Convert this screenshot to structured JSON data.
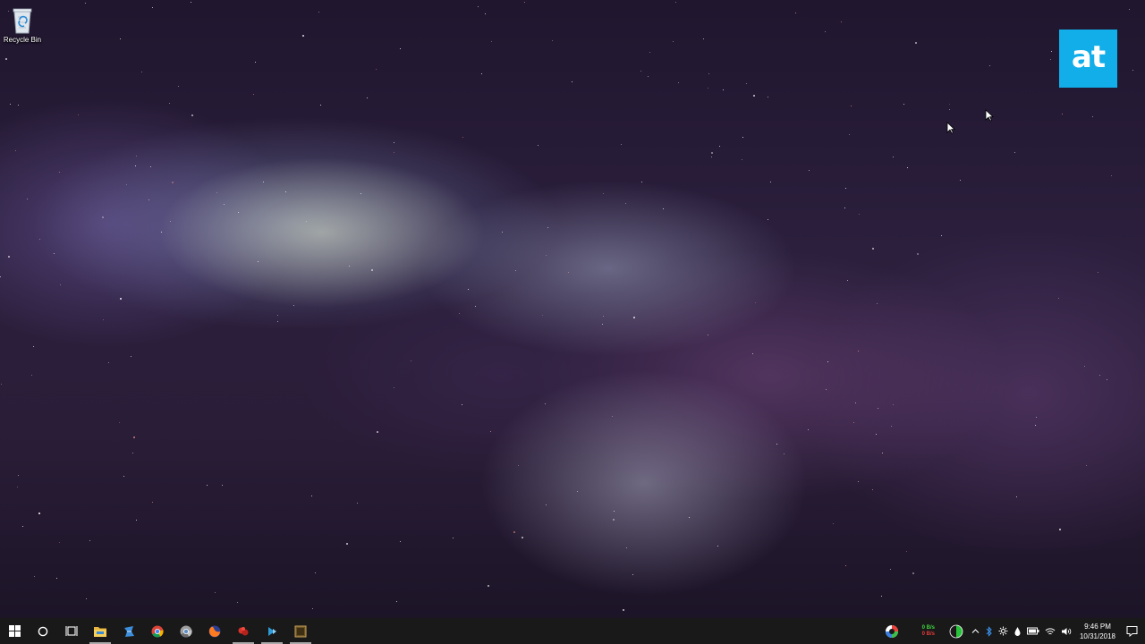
{
  "desktop": {
    "icons": [
      {
        "label": "Recycle Bin",
        "icon": "recycle-bin-icon"
      }
    ],
    "watermark": {
      "text": "at",
      "color": "#11aee9"
    }
  },
  "taskbar": {
    "background": "#191919",
    "pinned": [
      {
        "name": "start-button",
        "icon": "windows-logo-icon"
      },
      {
        "name": "search-button",
        "icon": "cortana-circle-icon"
      },
      {
        "name": "task-view-button",
        "icon": "task-view-icon"
      },
      {
        "name": "file-explorer-button",
        "icon": "folder-icon",
        "running": true
      },
      {
        "name": "app-button",
        "icon": "blue-ribbon-icon"
      },
      {
        "name": "chrome-button",
        "icon": "chrome-icon"
      },
      {
        "name": "chrome-canary-button",
        "icon": "chrome-icon"
      },
      {
        "name": "firefox-button",
        "icon": "firefox-icon"
      },
      {
        "name": "app-red-button",
        "icon": "red-app-icon",
        "running": true
      },
      {
        "name": "app-blue-button",
        "icon": "blue-app-icon",
        "running": true
      },
      {
        "name": "app-box-button",
        "icon": "box-app-icon",
        "running": true
      }
    ],
    "tray": {
      "net_speed": {
        "up": "0 B/s",
        "down": "0 B/s"
      },
      "icons": [
        "color-wheel-icon",
        "green-status-icon",
        "chevron-up-icon",
        "bluetooth-icon",
        "gear-icon",
        "drop-icon",
        "battery-icon",
        "wifi-icon",
        "volume-icon"
      ],
      "clock": {
        "time": "9:46 PM",
        "date": "10/31/2018"
      },
      "notification_icon": "action-center-icon"
    }
  }
}
